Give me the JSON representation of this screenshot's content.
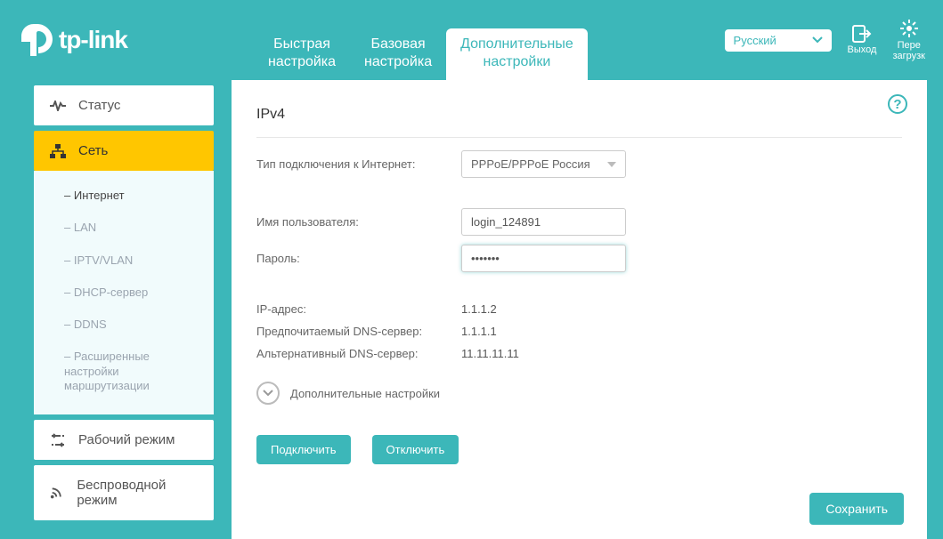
{
  "brand": "tp-link",
  "header": {
    "tabs": [
      {
        "label": "Быстрая\nнастройка"
      },
      {
        "label": "Базовая\nнастройка"
      },
      {
        "label": "Дополнительные\nнастройки"
      }
    ],
    "language": {
      "selected": "Русский"
    },
    "logout_label": "Выход",
    "reload_label": "Пере\nзагрузк"
  },
  "sidebar": {
    "status": "Статус",
    "network": "Сеть",
    "network_sub": [
      "Интернет",
      "LAN",
      "IPTV/VLAN",
      "DHCP-сервер",
      "DDNS",
      "Расширенные настройки маршрутизации"
    ],
    "op_mode": "Рабочий режим",
    "wireless": "Беспроводной режим"
  },
  "page": {
    "title": "IPv4",
    "conn_type_label": "Тип подключения к Интернет:",
    "conn_type_value": "PPPoE/PPPoE Россия",
    "username_label": "Имя пользователя:",
    "username_value": "login_124891",
    "password_label": "Пароль:",
    "password_value": "•••••••",
    "ip_label": "IP-адрес:",
    "ip_value": "1.1.1.2",
    "dns1_label": "Предпочитаемый DNS-сервер:",
    "dns1_value": "1.1.1.1",
    "dns2_label": "Альтернативный DNS-сервер:",
    "dns2_value": "11.11.11.11",
    "more_label": "Дополнительные настройки",
    "connect_label": "Подключить",
    "disconnect_label": "Отключить",
    "save_label": "Сохранить"
  }
}
